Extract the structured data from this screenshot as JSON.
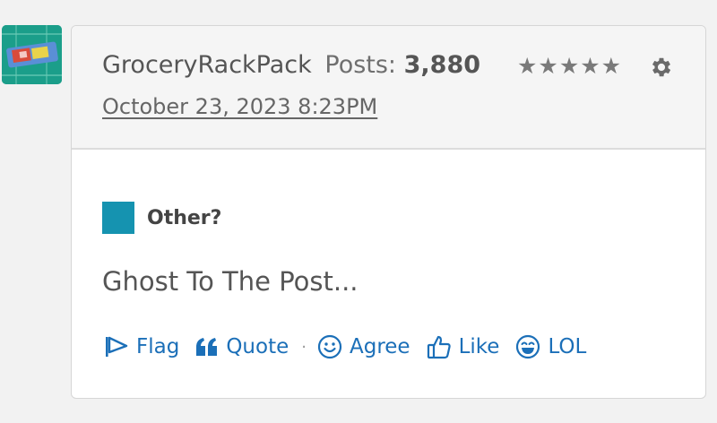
{
  "post": {
    "username": "GroceryRackPack",
    "posts_label": "Posts:",
    "posts_count": "3,880",
    "stars": "★★★★★",
    "date": "October 23, 2023 8:23PM",
    "category": "Other?",
    "body": "Ghost To The Post..."
  },
  "actions": {
    "flag": "Flag",
    "quote": "Quote",
    "separator": "·",
    "agree": "Agree",
    "like": "Like",
    "lol": "LOL"
  },
  "colors": {
    "link": "#1b6fb8",
    "category_swatch": "#1593b0",
    "avatar_bg": "#1b9e8a"
  }
}
